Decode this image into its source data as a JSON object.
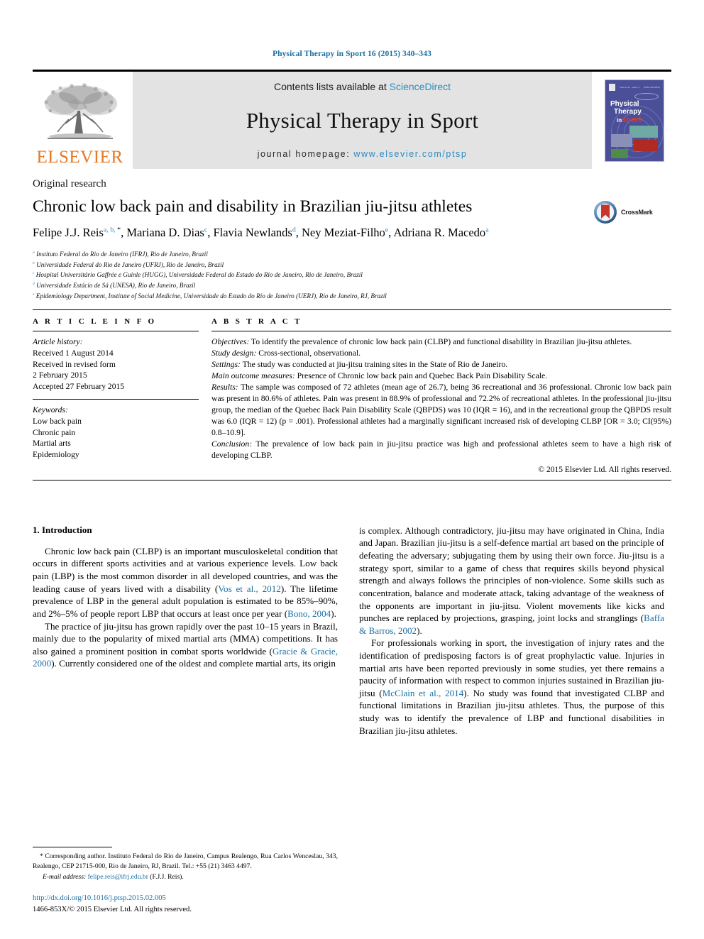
{
  "running_head": "Physical Therapy in Sport 16 (2015) 340–343",
  "masthead": {
    "publisher_logo_label": "ELSEVIER",
    "contents_prefix": "Contents lists available at",
    "contents_link": "ScienceDirect",
    "journal_title": "Physical Therapy in Sport",
    "homepage_prefix": "journal homepage:",
    "homepage_link": "www.elsevier.com/ptsp",
    "cover": {
      "line1": "Physical",
      "line2": "Therapy",
      "line3_small": "in",
      "line3_big": "sport",
      "top_meta_left": "Volume 16 · Issue 4",
      "top_meta_right": "ISSN 1466-853X"
    },
    "accent_orange": "#E87722",
    "link_blue": "#2d8bc0",
    "banner_bg": "#e3e3e3"
  },
  "article": {
    "kind": "Original research",
    "title": "Chronic low back pain and disability in Brazilian jiu-jitsu athletes",
    "crossmark_label": "CrossMark",
    "authors": [
      {
        "name": "Felipe J.J. Reis",
        "marks": "a, b, *"
      },
      {
        "name": "Mariana D. Dias",
        "marks": "c"
      },
      {
        "name": "Flavia Newlands",
        "marks": "d"
      },
      {
        "name": "Ney Meziat-Filho",
        "marks": "e"
      },
      {
        "name": "Adriana R. Macedo",
        "marks": "a"
      }
    ],
    "affiliations": [
      {
        "mark": "a",
        "text": "Instituto Federal do Rio de Janeiro (IFRJ), Rio de Janeiro, Brazil"
      },
      {
        "mark": "b",
        "text": "Universidade Federal do Rio de Janeiro (UFRJ), Rio de Janeiro, Brazil"
      },
      {
        "mark": "c",
        "text": "Hospital Universitário Gaffrée e Guinle (HUGG), Universidade Federal do Estado do Rio de Janeiro, Rio de Janeiro, Brazil"
      },
      {
        "mark": "d",
        "text": "Universidade Estácio de Sá (UNESA), Rio de Janeiro, Brazil"
      },
      {
        "mark": "e",
        "text": "Epidemiology Department, Institute of Social Medicine, Universidade do Estado do Rio de Janeiro (UERJ), Rio de Janeiro, RJ, Brazil"
      }
    ]
  },
  "article_info": {
    "heading": "A R T I C L E   I N F O",
    "history_label": "Article history:",
    "history": [
      "Received 1 August 2014",
      "Received in revised form",
      "2 February 2015",
      "Accepted 27 February 2015"
    ],
    "keywords_label": "Keywords:",
    "keywords": [
      "Low back pain",
      "Chronic pain",
      "Martial arts",
      "Epidemiology"
    ]
  },
  "abstract": {
    "heading": "A B S T R A C T",
    "sections": [
      {
        "label": "Objectives:",
        "text": " To identify the prevalence of chronic low back pain (CLBP) and functional disability in Brazilian jiu-jitsu athletes."
      },
      {
        "label": "Study design:",
        "text": " Cross-sectional, observational."
      },
      {
        "label": "Settings:",
        "text": " The study was conducted at jiu-jitsu training sites in the State of Rio de Janeiro."
      },
      {
        "label": "Main outcome measures:",
        "text": " Presence of Chronic low back pain and Quebec Back Pain Disability Scale."
      },
      {
        "label": "Results:",
        "text": " The sample was composed of 72 athletes (mean age of 26.7), being 36 recreational and 36 professional. Chronic low back pain was present in 80.6% of athletes. Pain was present in 88.9% of professional and 72.2% of recreational athletes. In the professional jiu-jitsu group, the median of the Quebec Back Pain Disability Scale (QBPDS) was 10 (IQR = 16), and in the recreational group the QBPDS result was 6.0 (IQR = 12) (p = .001). Professional athletes had a marginally significant increased risk of developing CLBP [OR = 3.0; CI(95%) 0.8–10.9]."
      },
      {
        "label": "Conclusion:",
        "text": " The prevalence of low back pain in jiu-jitsu practice was high and professional athletes seem to have a high risk of developing CLBP."
      }
    ],
    "copyright": "© 2015 Elsevier Ltd. All rights reserved."
  },
  "body": {
    "section_number_title": "1. Introduction",
    "left_paragraphs": [
      {
        "parts": [
          {
            "t": "Chronic low back pain (CLBP) is an important musculoskeletal condition that occurs in different sports activities and at various experience levels. Low back pain (LBP) is the most common disorder in all developed countries, and was the leading cause of years lived with a disability (",
            "link": false
          },
          {
            "t": "Vos et al., 2012",
            "link": true
          },
          {
            "t": "). The lifetime prevalence of LBP in the general adult population is estimated to be 85%–90%, and 2%–5% of people report LBP that occurs at least once per year (",
            "link": false
          },
          {
            "t": "Bono, 2004",
            "link": true
          },
          {
            "t": ").",
            "link": false
          }
        ]
      },
      {
        "parts": [
          {
            "t": "The practice of jiu-jitsu has grown rapidly over the past 10–15 years in Brazil, mainly due to the popularity of mixed martial arts (MMA) competitions. It has also gained a prominent position in combat sports worldwide (",
            "link": false
          },
          {
            "t": "Gracie & Gracie, 2000",
            "link": true
          },
          {
            "t": "). Currently considered one of the oldest and complete martial arts, its origin",
            "link": false
          }
        ]
      }
    ],
    "right_paragraphs": [
      {
        "continued": true,
        "parts": [
          {
            "t": "is complex. Although contradictory, jiu-jitsu may have originated in China, India and Japan. Brazilian jiu-jitsu is a self-defence martial art based on the principle of defeating the adversary; subjugating them by using their own force. Jiu-jitsu is a strategy sport, similar to a game of chess that requires skills beyond physical strength and always follows the principles of non-violence. Some skills such as concentration, balance and moderate attack, taking advantage of the weakness of the opponents are important in jiu-jitsu. Violent movements like kicks and punches are replaced by projections, grasping, joint locks and stranglings (",
            "link": false
          },
          {
            "t": "Baffa & Barros, 2002",
            "link": true
          },
          {
            "t": ").",
            "link": false
          }
        ]
      },
      {
        "continued": false,
        "parts": [
          {
            "t": "For professionals working in sport, the investigation of injury rates and the identification of predisposing factors is of great prophylactic value. Injuries in martial arts have been reported previously in some studies, yet there remains a paucity of information with respect to common injuries sustained in Brazilian jiu-jitsu (",
            "link": false
          },
          {
            "t": "McClain et al., 2014",
            "link": true
          },
          {
            "t": "). No study was found that investigated CLBP and functional limitations in Brazilian jiu-jitsu athletes. Thus, the purpose of this study was to identify the prevalence of LBP and functional disabilities in Brazilian jiu-jitsu athletes.",
            "link": false
          }
        ]
      }
    ]
  },
  "footnote": {
    "corresponding_star": "*",
    "corresponding_text": " Corresponding author. Instituto Federal do Rio de Janeiro, Campus Realengo, Rua Carlos Wenceslau, 343, Realengo, CEP 21715-000, Rio de Janeiro, RJ, Brazil. Tel.: +55 (21) 3463 4497.",
    "email_label": "E-mail address:",
    "email": "felipe.reis@ifrj.edu.br",
    "email_suffix": " (F.J.J. Reis).",
    "doi": "http://dx.doi.org/10.1016/j.ptsp.2015.02.005",
    "issn_line": "1466-853X/© 2015 Elsevier Ltd. All rights reserved."
  }
}
